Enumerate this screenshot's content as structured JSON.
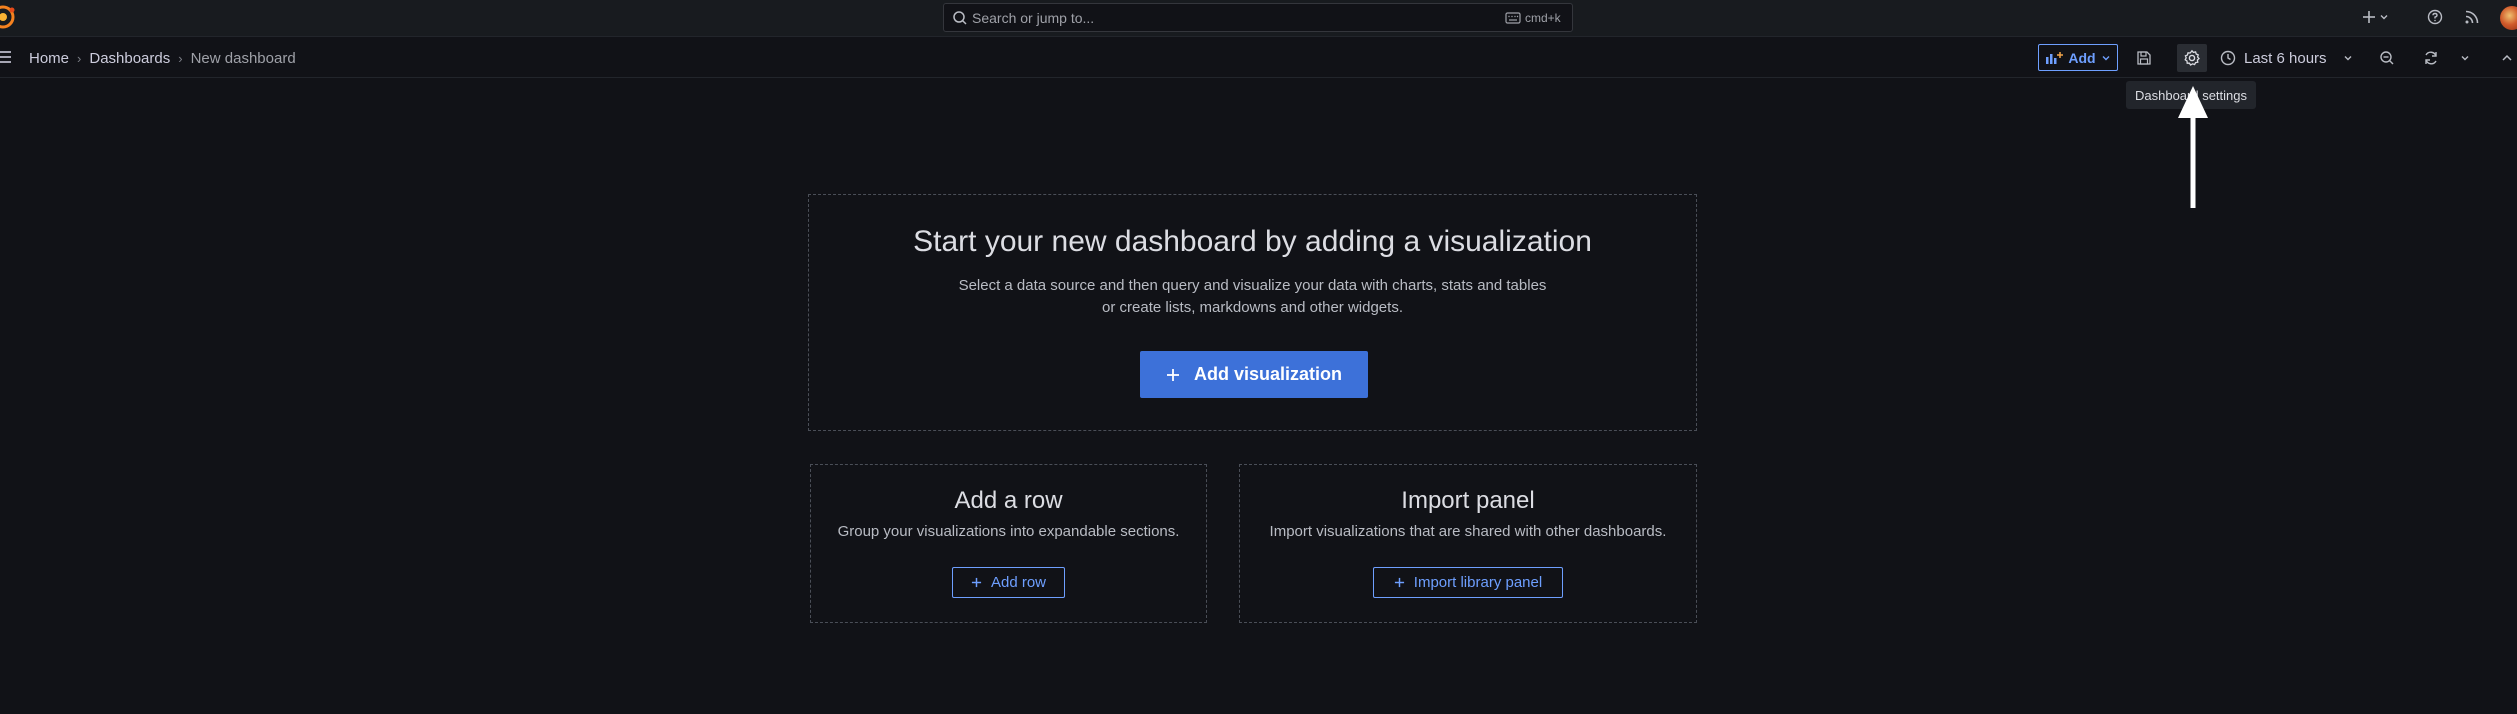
{
  "search": {
    "placeholder": "Search or jump to...",
    "shortcut": "cmd+k"
  },
  "breadcrumb": {
    "home": "Home",
    "dashboards": "Dashboards",
    "current": "New dashboard"
  },
  "toolbar": {
    "add_label": "Add",
    "time_range": "Last 6 hours",
    "settings_tooltip": "Dashboard settings"
  },
  "empty_state": {
    "title": "Start your new dashboard by adding a visualization",
    "subtitle_line1": "Select a data source and then query and visualize your data with charts, stats and tables",
    "subtitle_line2": "or create lists, markdowns and other widgets.",
    "add_visualization_label": "Add visualization"
  },
  "add_row_card": {
    "title": "Add a row",
    "subtitle": "Group your visualizations into expandable sections.",
    "button_label": "Add row"
  },
  "import_card": {
    "title": "Import panel",
    "subtitle": "Import visualizations that are shared with other dashboards.",
    "button_label": "Import library panel"
  },
  "icons": [
    "grafana-logo-icon",
    "search-icon",
    "keyboard-icon",
    "plus-icon",
    "chevron-down-icon",
    "help-icon",
    "rss-icon",
    "menu-icon",
    "add-panel-icon",
    "save-icon",
    "gear-icon",
    "clock-icon",
    "zoom-out-icon",
    "refresh-icon",
    "chevron-up-icon",
    "arrow-up-icon"
  ],
  "colors": {
    "background": "#111217",
    "topbar": "#181b1f",
    "primary": "#3d71d9",
    "primary_text": "#6e9fff",
    "text": "#ccccdc"
  }
}
